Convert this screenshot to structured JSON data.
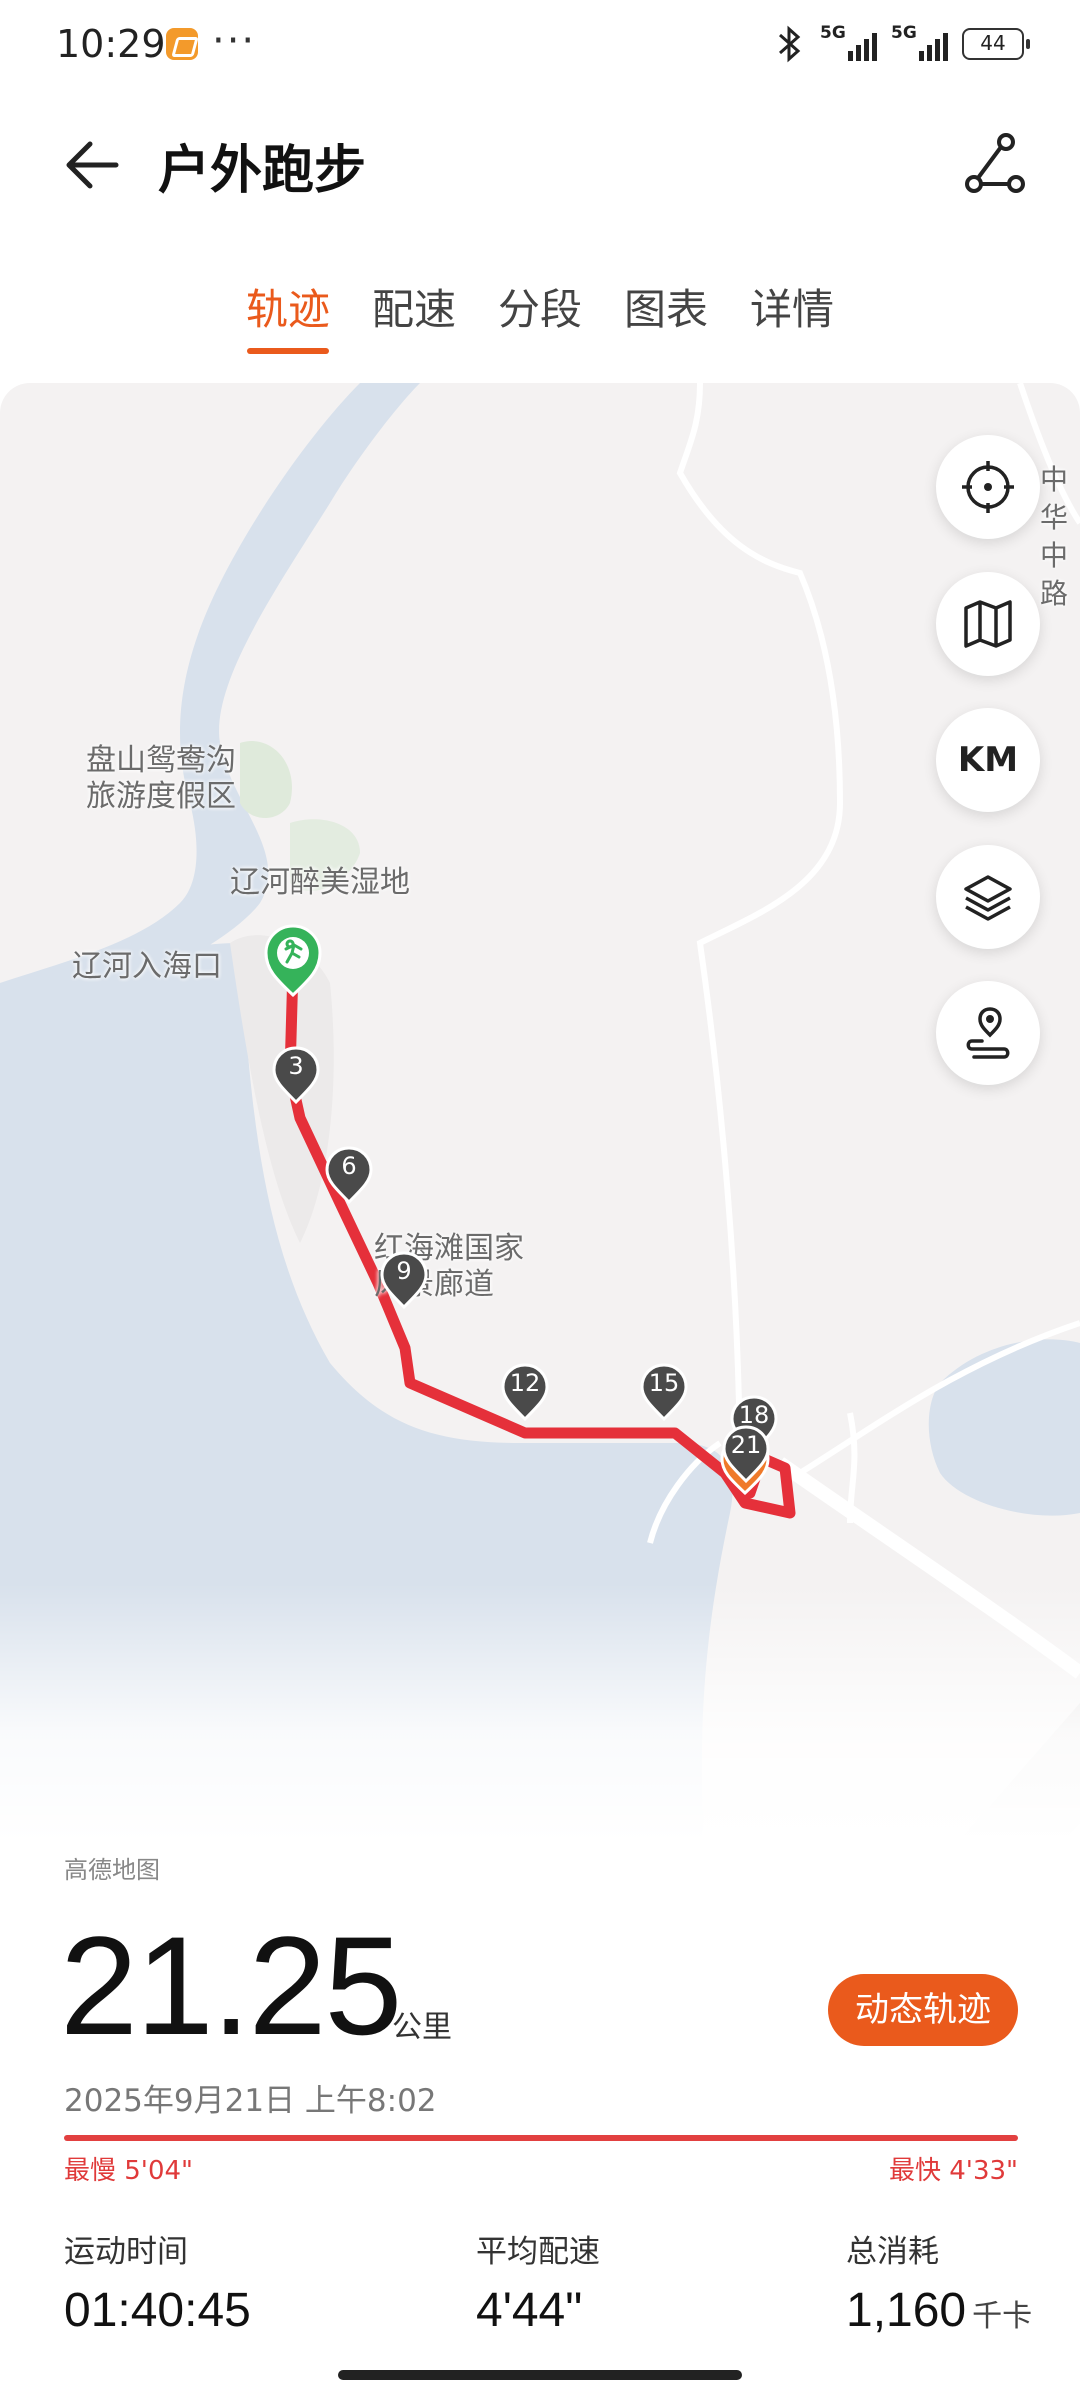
{
  "status_bar": {
    "time": "10:29",
    "dots": "···",
    "battery": "44",
    "signal_1": "5G",
    "signal_2": "5G"
  },
  "header": {
    "title": "户外跑步",
    "back_icon": "arrow-left-icon",
    "route_icon": "route-share-icon"
  },
  "tabs": [
    {
      "label": "轨迹",
      "active": true
    },
    {
      "label": "配速",
      "active": false
    },
    {
      "label": "分段",
      "active": false
    },
    {
      "label": "图表",
      "active": false
    },
    {
      "label": "详情",
      "active": false
    }
  ],
  "map": {
    "labels": {
      "resort": "盘山鸳鸯沟\n旅游度假区",
      "wetland": "辽河醉美湿地",
      "estuary": "辽河入海口",
      "corridor": "红海滩国家\n风景廊道",
      "road": "中\n华\n中\n路"
    },
    "controls": {
      "locate": "crosshair-icon",
      "map": "map-icon",
      "km": "KM",
      "layers": "layers-icon",
      "route": "route-pin-icon"
    },
    "km_markers": [
      "3",
      "6",
      "9",
      "12",
      "15",
      "18",
      "21"
    ],
    "provider": "高德地图",
    "route_color": "#e5303a"
  },
  "summary": {
    "distance": "21.25",
    "distance_unit": "公里",
    "dynamic_button": "动态轨迹",
    "date": "2025年9月21日 上午8:02",
    "slowest": "最慢 5'04\"",
    "fastest": "最快 4'33\""
  },
  "stats": [
    {
      "label": "运动时间",
      "value": "01:40:45",
      "unit": ""
    },
    {
      "label": "平均配速",
      "value": "4'44\"",
      "unit": ""
    },
    {
      "label": "总消耗",
      "value": "1,160",
      "unit": "千卡"
    }
  ],
  "accent_color": "#ea5a1c"
}
